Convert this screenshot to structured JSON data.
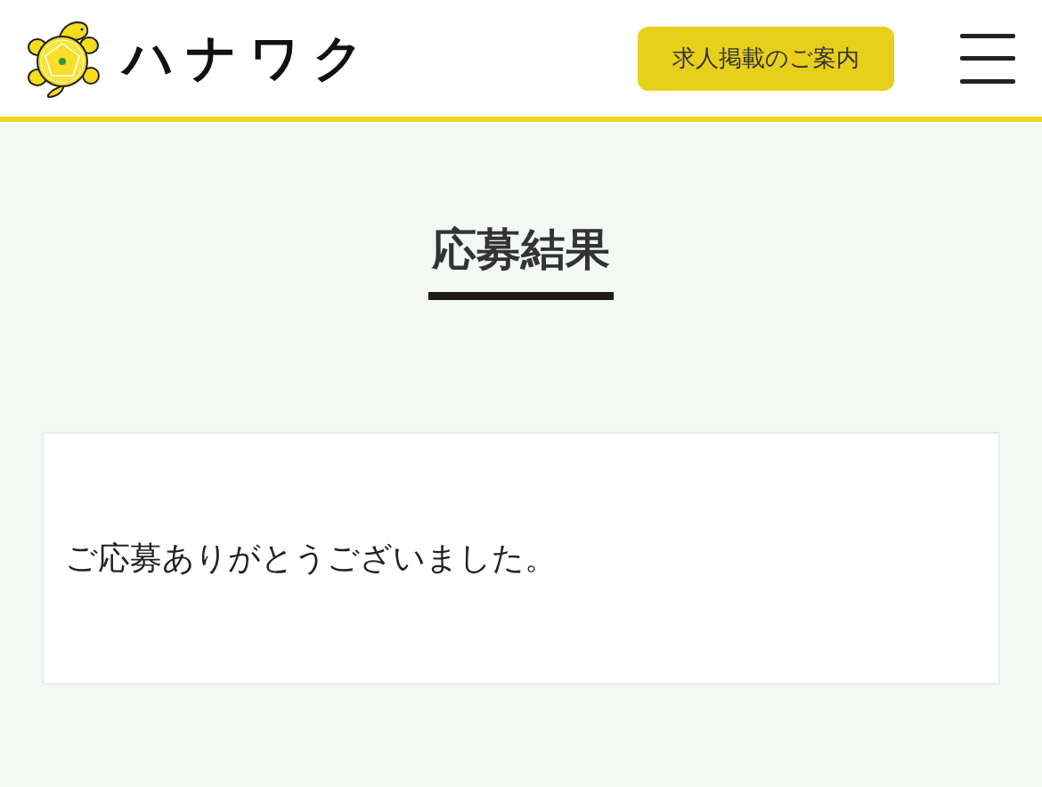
{
  "header": {
    "logo_text": "ハナワク",
    "cta_button": "求人掲載のご案内"
  },
  "page_title": "応募結果",
  "message": "ご応募ありがとうございました。"
}
